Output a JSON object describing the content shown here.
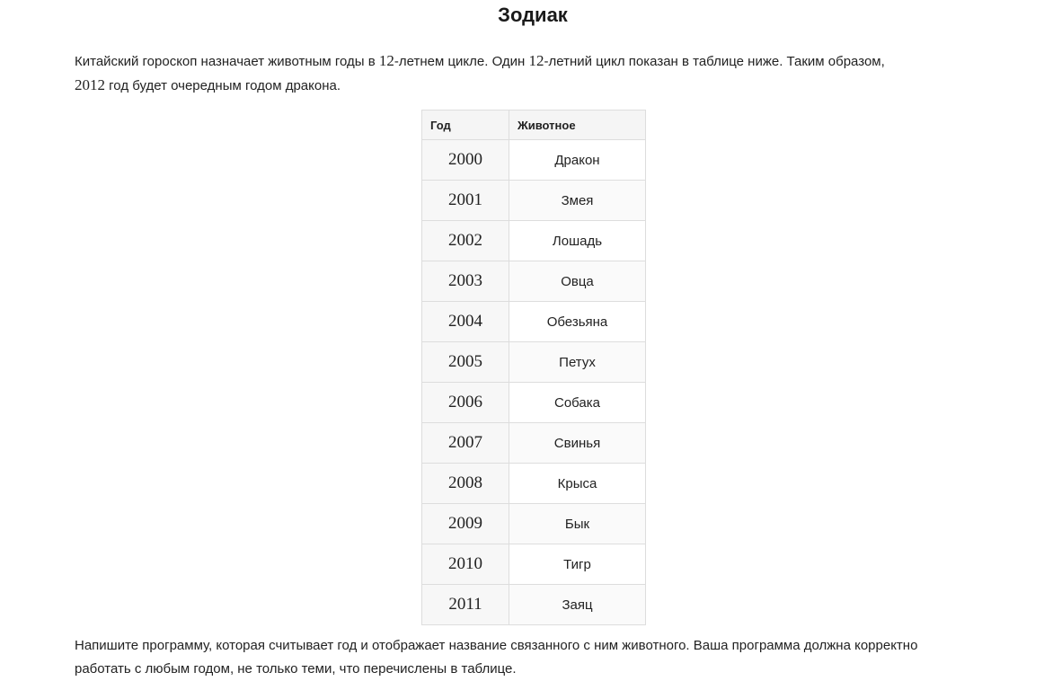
{
  "title": "Зодиак",
  "intro": {
    "part1": "Китайский гороскоп назначает животным годы в ",
    "num1": "12",
    "part2": "-летнем цикле. Один ",
    "num2": "12",
    "part3": "-летний цикл показан в таблице ниже. Таким образом, ",
    "num3": "2012",
    "part4": " год будет очередным годом дракона."
  },
  "table": {
    "headers": [
      "Год",
      "Животное"
    ],
    "rows": [
      {
        "year": "2000",
        "animal": "Дракон"
      },
      {
        "year": "2001",
        "animal": "Змея"
      },
      {
        "year": "2002",
        "animal": "Лошадь"
      },
      {
        "year": "2003",
        "animal": "Овца"
      },
      {
        "year": "2004",
        "animal": "Обезьяна"
      },
      {
        "year": "2005",
        "animal": "Петух"
      },
      {
        "year": "2006",
        "animal": "Собака"
      },
      {
        "year": "2007",
        "animal": "Свинья"
      },
      {
        "year": "2008",
        "animal": "Крыса"
      },
      {
        "year": "2009",
        "animal": "Бык"
      },
      {
        "year": "2010",
        "animal": "Тигр"
      },
      {
        "year": "2011",
        "animal": "Заяц"
      }
    ]
  },
  "task": "Напишите программу, которая считывает год и отображает название связанного с ним животного. Ваша программа должна корректно работать с любым годом, не только теми, что перечислены в таблице."
}
